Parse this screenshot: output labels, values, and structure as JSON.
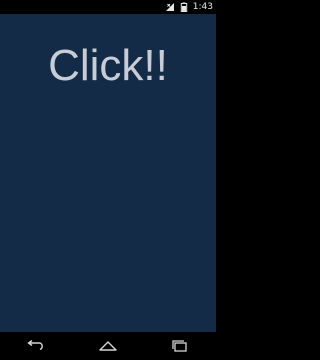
{
  "status_bar": {
    "time": "1:43",
    "icons": [
      "signal-icon",
      "battery-icon"
    ]
  },
  "main": {
    "click_label": "Click!!"
  },
  "nav_bar": {
    "buttons": [
      "back-icon",
      "home-icon",
      "recents-icon"
    ]
  },
  "colors": {
    "background": "#142b47",
    "text": "#c7ccd6",
    "bars": "#000000"
  }
}
